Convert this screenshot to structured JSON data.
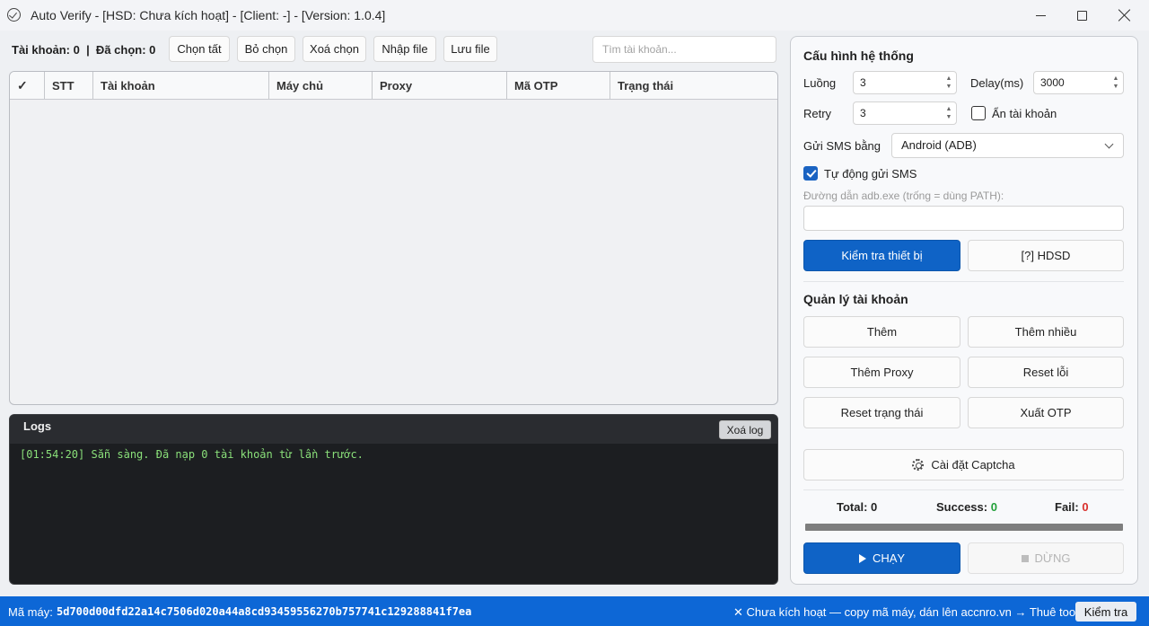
{
  "window": {
    "title": "Auto Verify - [HSD: Chưa kích hoạt] - [Client: -] - [Version: 1.0.4]"
  },
  "toolbar": {
    "counts": "Tài khoản: 0  |  Đã chọn: 0",
    "select_all": "Chọn tất",
    "deselect": "Bỏ chọn",
    "delete_selected": "Xoá chọn",
    "import_file": "Nhập file",
    "save_file": "Lưu file",
    "search_placeholder": "Tìm tài khoản..."
  },
  "table": {
    "columns": [
      "✓",
      "STT",
      "Tài khoản",
      "Máy chủ",
      "Proxy",
      "Mã OTP",
      "Trạng thái"
    ],
    "rows": []
  },
  "logs": {
    "title": "Logs",
    "clear_label": "Xoá log",
    "lines": [
      "[01:54:20] Sẵn sàng. Đã nạp 0 tài khoản từ lần trước."
    ]
  },
  "config": {
    "title": "Cấu hình hệ thống",
    "threads_label": "Luồng",
    "threads_value": "3",
    "delay_label": "Delay(ms)",
    "delay_value": "3000",
    "retry_label": "Retry",
    "retry_value": "3",
    "hide_accounts_label": "Ẩn tài khoản",
    "hide_accounts_checked": false,
    "sms_label": "Gửi SMS bằng",
    "sms_value": "Android (ADB)",
    "auto_sms_label": "Tự động gửi SMS",
    "auto_sms_checked": true,
    "adb_path_hint": "Đường dẫn adb.exe (trống = dùng PATH):",
    "adb_path_value": "",
    "check_device": "Kiểm tra thiết bị",
    "guide": "[?] HDSD"
  },
  "accounts": {
    "title": "Quản lý tài khoản",
    "add": "Thêm",
    "add_many": "Thêm nhiều",
    "add_proxy": "Thêm Proxy",
    "reset_errors": "Reset lỗi",
    "reset_status": "Reset trạng thái",
    "export_otp": "Xuất OTP",
    "captcha_settings": "Cài đặt Captcha"
  },
  "stats": {
    "total_label": "Total:",
    "total": "0",
    "success_label": "Success:",
    "success": "0",
    "fail_label": "Fail:",
    "fail": "0",
    "progress": 0
  },
  "run": {
    "start": "CHẠY",
    "stop": "DỪNG"
  },
  "statusbar": {
    "machine_label": "Mã máy:",
    "machine_code": "5d700d00dfd22a14c7506d020a44a8cd93459556270b757741c129288841f7ea",
    "message": "✕ Chưa kích hoạt — copy mã máy, dán lên accnro.vn → Thuê tool",
    "check_label": "Kiểm tra"
  },
  "colors": {
    "accent": "#0f63c6",
    "statusbar": "#0d67d6",
    "success": "#23a03a",
    "fail": "#d9302c",
    "log_text": "#8ae07a"
  },
  "icons": [
    "check-circle-icon",
    "minimize-icon",
    "maximize-icon",
    "close-icon",
    "spin-arrows-icon",
    "chevron-down-icon",
    "gear-icon",
    "play-icon",
    "stop-icon"
  ]
}
